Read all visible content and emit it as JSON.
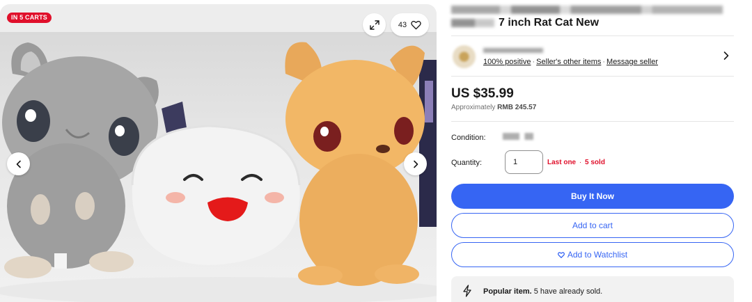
{
  "gallery": {
    "cart_badge": "IN 5 CARTS",
    "watch_count": "43"
  },
  "listing": {
    "title_visible": "7 inch Rat Cat New"
  },
  "seller": {
    "feedback": "100% positive",
    "other_items": "Seller's other items",
    "message": "Message seller"
  },
  "pricing": {
    "price": "US $35.99",
    "approx_prefix": "Approximately",
    "approx_value": "RMB 245.57"
  },
  "details": {
    "condition_label": "Condition:",
    "quantity_label": "Quantity:",
    "quantity_value": "1",
    "stock_last": "Last one",
    "stock_sep": "·",
    "stock_sold": "5 sold"
  },
  "actions": {
    "buy_now": "Buy It Now",
    "add_to_cart": "Add to cart",
    "add_to_watchlist": "Add to Watchlist"
  },
  "popular": {
    "bold": "Popular item.",
    "rest": "5 have already sold."
  },
  "colors": {
    "accent": "#3665f3",
    "alert": "#e0102b"
  }
}
